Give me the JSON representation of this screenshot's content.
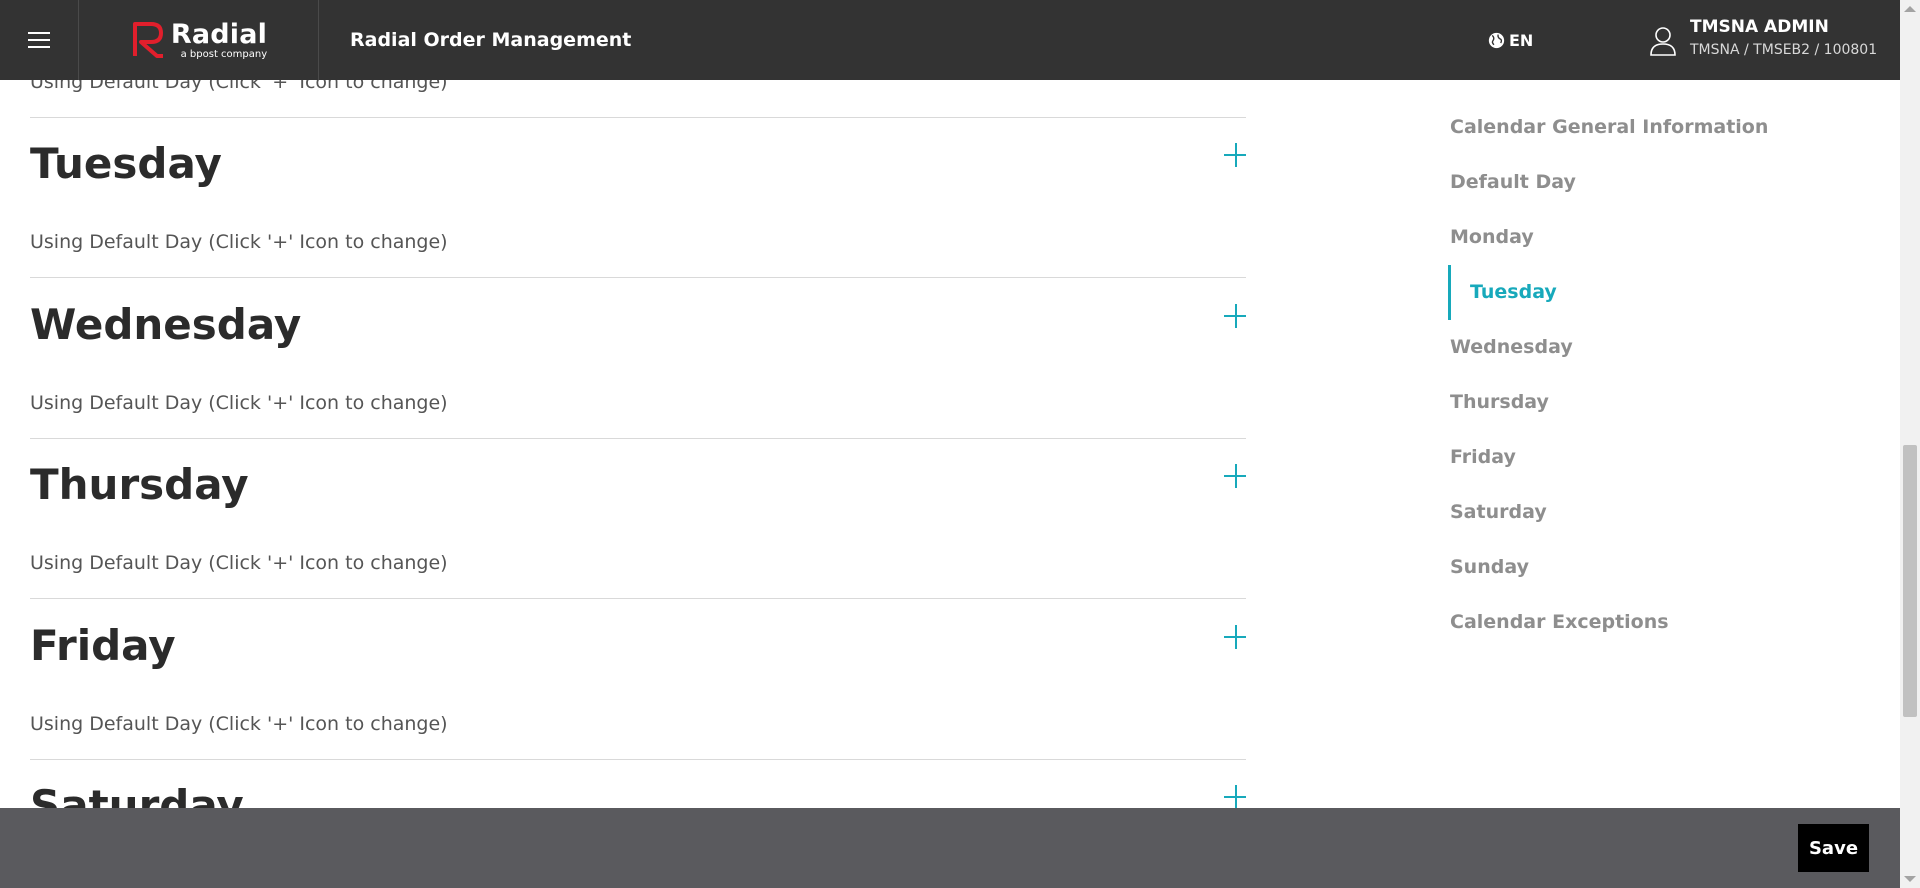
{
  "header": {
    "brand": "Radial",
    "brand_sub": "a bpost company",
    "app_title": "Radial Order Management",
    "language": "EN",
    "user_name": "TMSNA ADMIN",
    "user_org": "TMSNA / TMSEB2 / 100801"
  },
  "main": {
    "partial_note": "Using Default Day (Click '+' Icon to change)",
    "days": [
      {
        "title": "Tuesday",
        "note": "Using Default Day (Click '+' Icon to change)"
      },
      {
        "title": "Wednesday",
        "note": "Using Default Day (Click '+' Icon to change)"
      },
      {
        "title": "Thursday",
        "note": "Using Default Day (Click '+' Icon to change)"
      },
      {
        "title": "Friday",
        "note": "Using Default Day (Click '+' Icon to change)"
      },
      {
        "title": "Saturday",
        "note": ""
      }
    ]
  },
  "side_nav": {
    "items": [
      {
        "label": "Calendar General Information"
      },
      {
        "label": "Default Day"
      },
      {
        "label": "Monday"
      },
      {
        "label": "Tuesday",
        "active": true
      },
      {
        "label": "Wednesday"
      },
      {
        "label": "Thursday"
      },
      {
        "label": "Friday"
      },
      {
        "label": "Saturday"
      },
      {
        "label": "Sunday"
      },
      {
        "label": "Calendar Exceptions"
      }
    ]
  },
  "footer": {
    "save_label": "Save"
  },
  "colors": {
    "accent": "#17a9bb",
    "brand_red": "#e11f2c",
    "topbar": "#333333",
    "footer": "#5a5a5e"
  },
  "icons": [
    "menu-icon",
    "radial-logo-icon",
    "globe-icon",
    "user-icon",
    "plus-icon"
  ]
}
